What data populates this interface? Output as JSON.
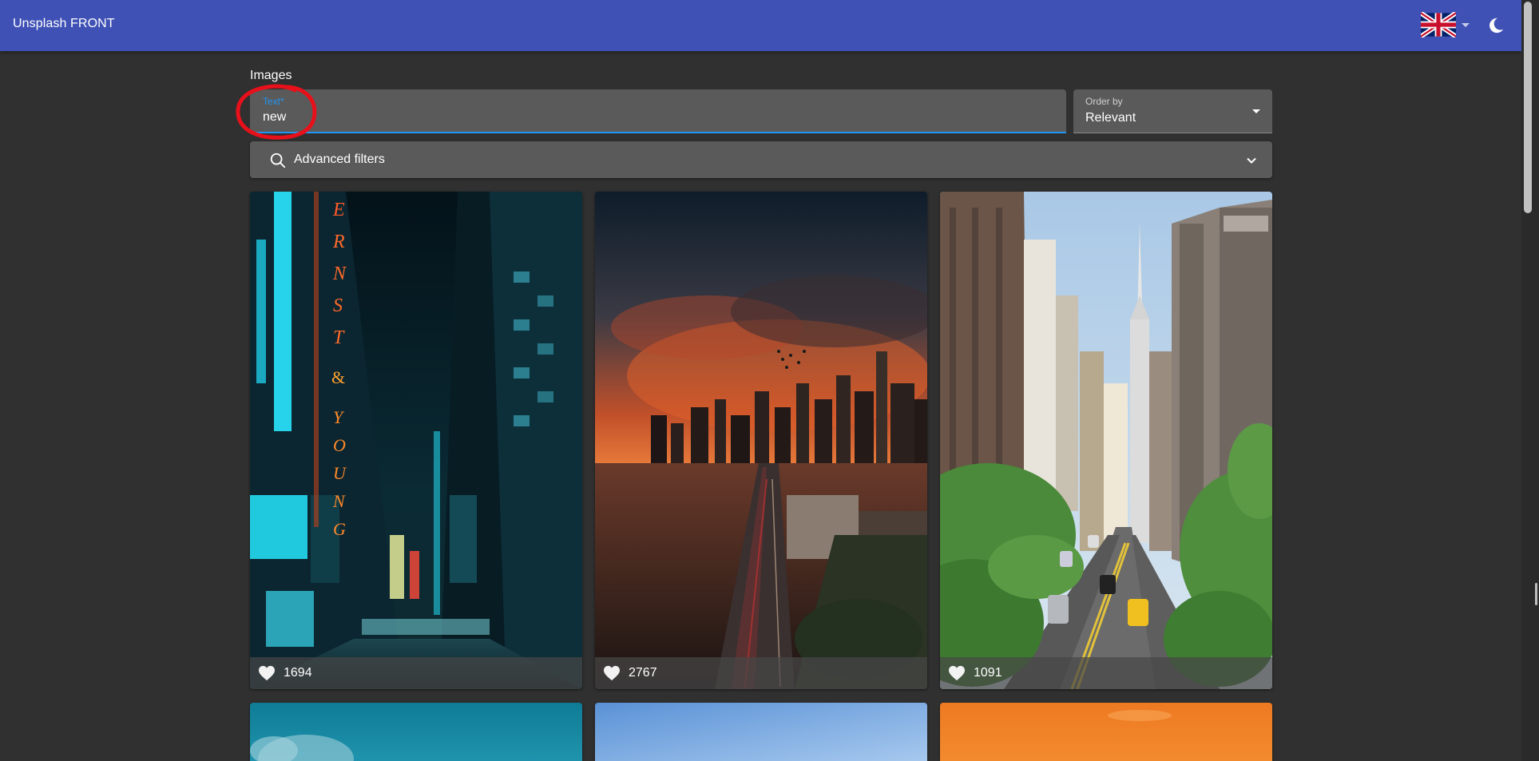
{
  "appbar": {
    "title": "Unsplash FRONT",
    "language_icon": "uk-flag-icon",
    "theme_icon": "moon-icon",
    "color": "#3f51b5"
  },
  "search": {
    "section_title": "Images",
    "text_label": "Text*",
    "text_value": "new",
    "order_label": "Order by",
    "order_value": "Relevant",
    "filters_label": "Advanced filters"
  },
  "cards": [
    {
      "likes": "1694",
      "subject": "neon city street at night"
    },
    {
      "likes": "2767",
      "subject": "city skyline at sunset with highway"
    },
    {
      "likes": "1091",
      "subject": "avenue with skyscrapers and trees"
    },
    {
      "subject": "teal sky"
    },
    {
      "subject": "blue sky"
    },
    {
      "subject": "orange sky"
    }
  ],
  "colors": {
    "accent": "#2196f3",
    "background": "#303030",
    "field": "#5a5a5a",
    "annotation": "#e8101a"
  }
}
